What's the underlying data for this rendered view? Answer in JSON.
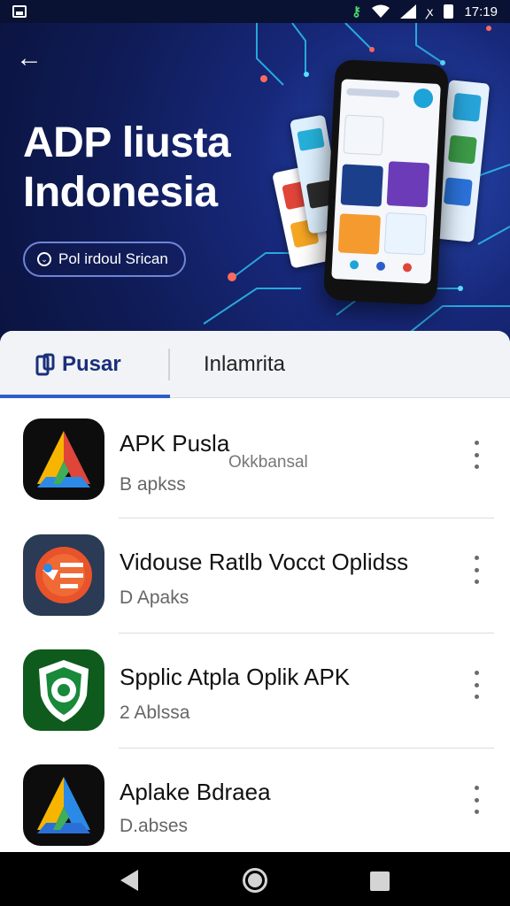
{
  "status_bar": {
    "time": "17:19",
    "icons": [
      "screenshot-icon",
      "vpn-key-icon",
      "wifi-icon",
      "signal-icon",
      "nfc-icon",
      "battery-icon"
    ]
  },
  "hero": {
    "title_line1": "ADP liusta",
    "title_line2": "Indonesia",
    "pill_label": "Pol irdoul Srican",
    "accent_color": "#0f1b55"
  },
  "tabs": [
    {
      "label": "Pusar",
      "active": true
    },
    {
      "label": "Inlamrita",
      "active": false
    }
  ],
  "apps": [
    {
      "title": "APK Pusla",
      "subtitle": "B apkss",
      "extra": "Okkbansal",
      "icon": "aplikasi-a-icon"
    },
    {
      "title": "Vidouse Ratlb Vocct Oplidss",
      "subtitle": "D Apaks",
      "extra": "",
      "icon": "browser-icon"
    },
    {
      "title": "Spplic Atpla Oplik APK",
      "subtitle": "2 Ablssa",
      "extra": "",
      "icon": "shield-icon"
    },
    {
      "title": "Aplake Bdraea",
      "subtitle": "D.abses",
      "extra": "",
      "icon": "aplikasi-a-icon"
    }
  ],
  "colors": {
    "accent": "#2b5fc7",
    "hero_bg": "#0f1b55"
  }
}
